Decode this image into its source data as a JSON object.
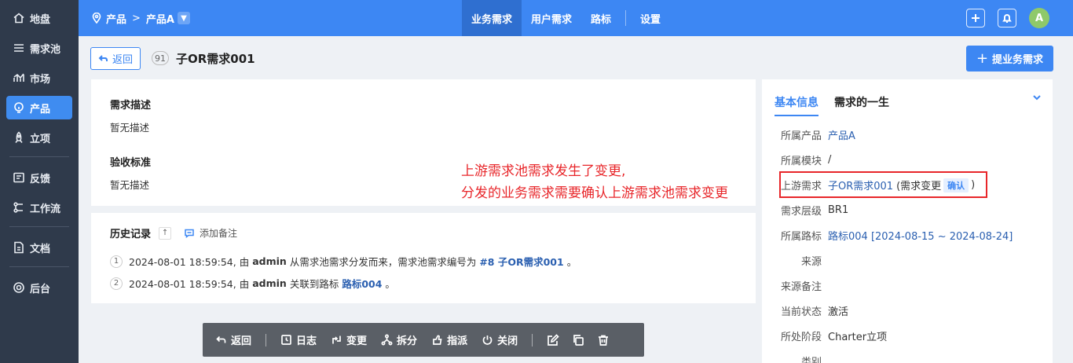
{
  "sidebar": {
    "items": [
      {
        "label": "地盘",
        "icon": "home-icon"
      },
      {
        "label": "需求池",
        "icon": "list-icon"
      },
      {
        "label": "市场",
        "icon": "chart-icon"
      },
      {
        "label": "产品",
        "icon": "bulb-icon",
        "active": true
      },
      {
        "label": "立项",
        "icon": "rocket-icon"
      },
      {
        "label": "反馈",
        "icon": "feedback-icon"
      },
      {
        "label": "工作流",
        "icon": "workflow-icon"
      },
      {
        "label": "文档",
        "icon": "doc-icon"
      },
      {
        "label": "后台",
        "icon": "gear-icon"
      }
    ]
  },
  "topbar": {
    "breadcrumb_root": "产品",
    "breadcrumb_separator": ">",
    "breadcrumb_current": "产品A",
    "tabs": [
      {
        "label": "业务需求",
        "active": true
      },
      {
        "label": "用户需求"
      },
      {
        "label": "路标"
      },
      {
        "label": "设置"
      }
    ],
    "avatar_initial": "A"
  },
  "header": {
    "back_label": "返回",
    "id_badge": "91",
    "title": "子OR需求001",
    "submit_label": "提业务需求"
  },
  "description": {
    "desc_title": "需求描述",
    "desc_text": "暂无描述",
    "accept_title": "验收标准",
    "accept_text": "暂无描述"
  },
  "history": {
    "title": "历史记录",
    "sort_symbol": "↑",
    "add_note": "添加备注",
    "entries": [
      {
        "num": "1",
        "prefix": "2024-08-01 18:59:54, 由",
        "user": "admin",
        "middle": "从需求池需求分发而来，需求池需求编号为",
        "link": "#8 子OR需求001",
        "suffix": "。"
      },
      {
        "num": "2",
        "prefix": "2024-08-01 18:59:54, 由",
        "user": "admin",
        "middle": "关联到路标",
        "link": "路标004",
        "suffix": "。"
      }
    ]
  },
  "annotation": {
    "line1": "上游需求池需求发生了变更,",
    "line2": "分发的业务需求需要确认上游需求池需求变更"
  },
  "info": {
    "tabs": [
      {
        "label": "基本信息",
        "active": true
      },
      {
        "label": "需求的一生"
      }
    ],
    "rows": {
      "product": {
        "label": "所属产品",
        "value": "产品A"
      },
      "module": {
        "label": "所属模块",
        "value": "/"
      },
      "upstream": {
        "label": "上游需求",
        "value": "子OR需求001",
        "change_open": "(需求变更",
        "confirm": "确认",
        "change_close": ")"
      },
      "level": {
        "label": "需求层级",
        "value": "BR1"
      },
      "roadmap": {
        "label": "所属路标",
        "value": "路标004 [2024-08-15 ~ 2024-08-24]"
      },
      "source": {
        "label": "来源",
        "value": ""
      },
      "source_note": {
        "label": "来源备注",
        "value": ""
      },
      "status": {
        "label": "当前状态",
        "value": "激活"
      },
      "stage": {
        "label": "所处阶段",
        "value": "Charter立项"
      },
      "category": {
        "label": "类别",
        "value": ""
      }
    }
  },
  "toolbar": {
    "back": "返回",
    "log": "日志",
    "change": "变更",
    "split": "拆分",
    "assign": "指派",
    "close": "关闭"
  },
  "colors": {
    "primary": "#3d87f3",
    "sidebar": "#2f3a4b",
    "annotation": "#e8262a"
  }
}
